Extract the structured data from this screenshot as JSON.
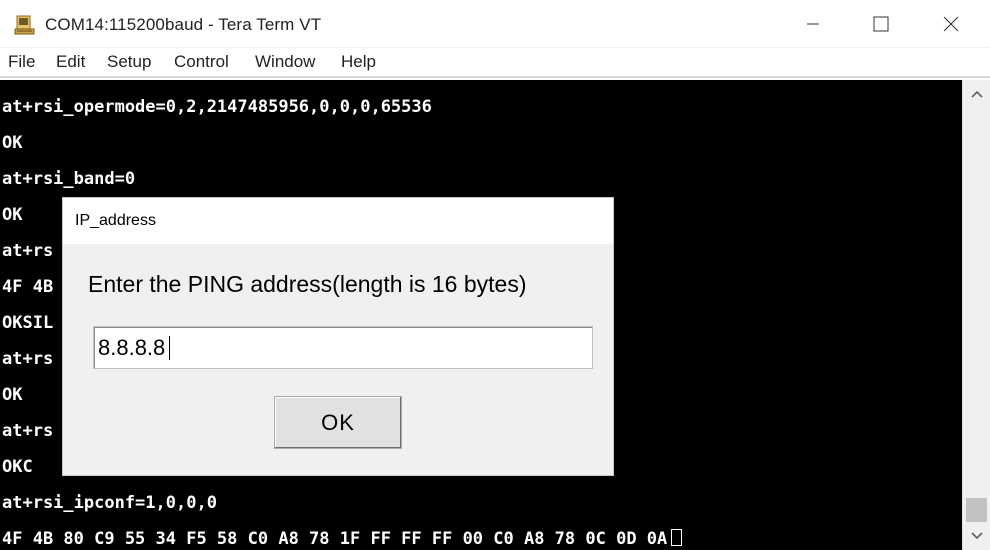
{
  "window": {
    "title": "COM14:115200baud - Tera Term VT",
    "icon": "tera-term-app-icon",
    "controls": {
      "minimize": "minimize-icon",
      "maximize": "maximize-icon",
      "close": "close-icon"
    }
  },
  "menu": [
    "File",
    "Edit",
    "Setup",
    "Control",
    "Window",
    "Help"
  ],
  "terminal": {
    "lines": [
      "at+rsi_opermode=0,2,2147485956,0,0,0,65536",
      "OK",
      "at+rsi_band=0",
      "OK",
      "at+rs",
      "4F 4B",
      "OKSIL",
      "at+rs",
      "OK",
      "at+rs",
      "OKC",
      "at+rsi_ipconf=1,0,0,0",
      "4F 4B 80 C9 55 34 F5 58 C0 A8 78 1F FF FF FF 00 C0 A8 78 0C 0D 0A"
    ],
    "colors": {
      "background": "#000000",
      "text": "#ffffff"
    }
  },
  "dialog": {
    "title": "IP_address",
    "prompt": "Enter the PING address(length is 16 bytes)",
    "input_value": "8.8.8.8",
    "ok_label": "OK"
  },
  "scrollbar": {
    "up": "chevron-up-icon",
    "down": "chevron-down-icon"
  }
}
